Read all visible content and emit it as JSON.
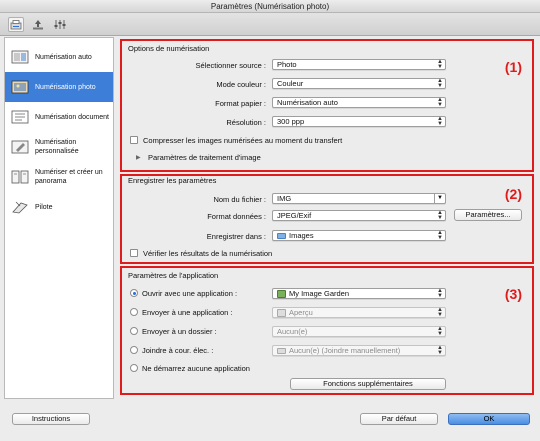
{
  "window": {
    "title": "Paramètres (Numérisation photo)"
  },
  "toolbar": {
    "icons": [
      "scan-from-computer-icon",
      "scan-from-panel-icon",
      "general-settings-icon"
    ]
  },
  "sidebar": {
    "items": [
      {
        "label": "Numérisation auto",
        "icon": "auto-scan-icon",
        "selected": false
      },
      {
        "label": "Numérisation photo",
        "icon": "photo-scan-icon",
        "selected": true
      },
      {
        "label": "Numérisation document",
        "icon": "document-scan-icon",
        "selected": false
      },
      {
        "label": "Numérisation personnalisée",
        "icon": "custom-scan-icon",
        "selected": false
      },
      {
        "label": "Numériser et créer un panorama",
        "icon": "panorama-icon",
        "selected": false
      },
      {
        "label": "Pilote",
        "icon": "driver-icon",
        "selected": false
      }
    ]
  },
  "scan_options": {
    "title": "Options de numérisation",
    "number": "(1)",
    "source_label": "Sélectionner source :",
    "source_value": "Photo",
    "color_label": "Mode couleur :",
    "color_value": "Couleur",
    "paper_label": "Format papier :",
    "paper_value": "Numérisation auto",
    "resolution_label": "Résolution :",
    "resolution_value": "300 ppp",
    "compress_label": "Compresser les images numérisées au moment du transfert",
    "image_processing_label": "Paramètres de traitement d'image"
  },
  "save_settings": {
    "title": "Enregistrer les paramètres",
    "number": "(2)",
    "filename_label": "Nom du fichier :",
    "filename_value": "IMG",
    "format_label": "Format données :",
    "format_value": "JPEG/Exif",
    "format_settings_button": "Paramètres...",
    "save_in_label": "Enregistrer dans :",
    "save_in_value": "Images",
    "verify_label": "Vérifier les résultats de la numérisation"
  },
  "app_settings": {
    "title": "Paramètres de l'application",
    "number": "(3)",
    "open_label": "Ouvrir avec une application :",
    "open_value": "My Image Garden",
    "send_app_label": "Envoyer à une application :",
    "send_app_value": "Aperçu",
    "send_folder_label": "Envoyer à un dossier :",
    "send_folder_value": "Aucun(e)",
    "email_label": "Joindre à cour. élec. :",
    "email_value": "Aucun(e) (Joindre manuellement)",
    "none_label": "Ne démarrez aucune application",
    "more_button": "Fonctions supplémentaires"
  },
  "footer": {
    "instructions_button": "Instructions",
    "default_button": "Par défaut",
    "ok_button": "OK"
  },
  "colors": {
    "highlight": "#e01b1b",
    "selection": "#3d7ed8"
  }
}
